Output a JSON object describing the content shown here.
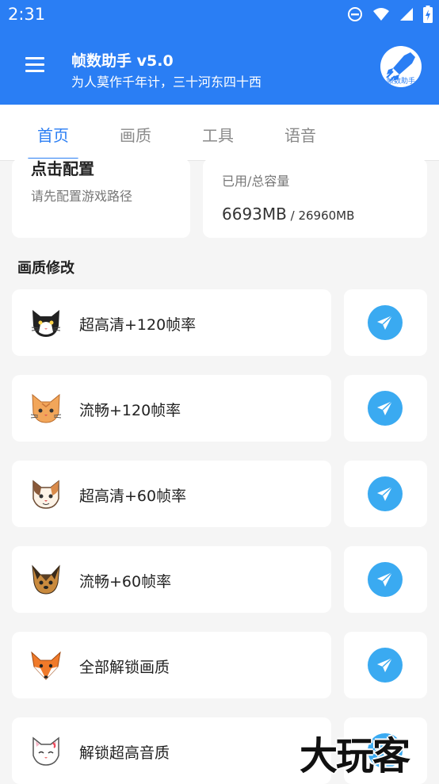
{
  "status_bar": {
    "time": "2:31"
  },
  "app_bar": {
    "title": "帧数助手 v5.0",
    "subtitle": "为人莫作千年计，三十河东四十西",
    "logo_text": "帧数助手"
  },
  "tabs": [
    {
      "label": "首页",
      "active": true
    },
    {
      "label": "画质",
      "active": false
    },
    {
      "label": "工具",
      "active": false
    },
    {
      "label": "语音",
      "active": false
    }
  ],
  "config_card": {
    "title": "点击配置",
    "subtitle": "请先配置游戏路径"
  },
  "storage_card": {
    "label": "已用/总容量",
    "used": "6693MB",
    "total": " / 26960MB"
  },
  "section_title": "画质修改",
  "items": [
    {
      "label": "超高清+120帧率",
      "icon": "black-white-cat-icon"
    },
    {
      "label": "流畅+120帧率",
      "icon": "orange-cat-icon"
    },
    {
      "label": "超高清+60帧率",
      "icon": "calico-cat-icon"
    },
    {
      "label": "流畅+60帧率",
      "icon": "yorkie-dog-icon"
    },
    {
      "label": "全部解锁画质",
      "icon": "fox-icon"
    },
    {
      "label": "解锁超高音质",
      "icon": "white-cat-icon"
    }
  ],
  "watermark": "大玩客",
  "colors": {
    "primary": "#2a7ef4",
    "send_button": "#3aaaf1",
    "background": "#f5f5f5"
  }
}
